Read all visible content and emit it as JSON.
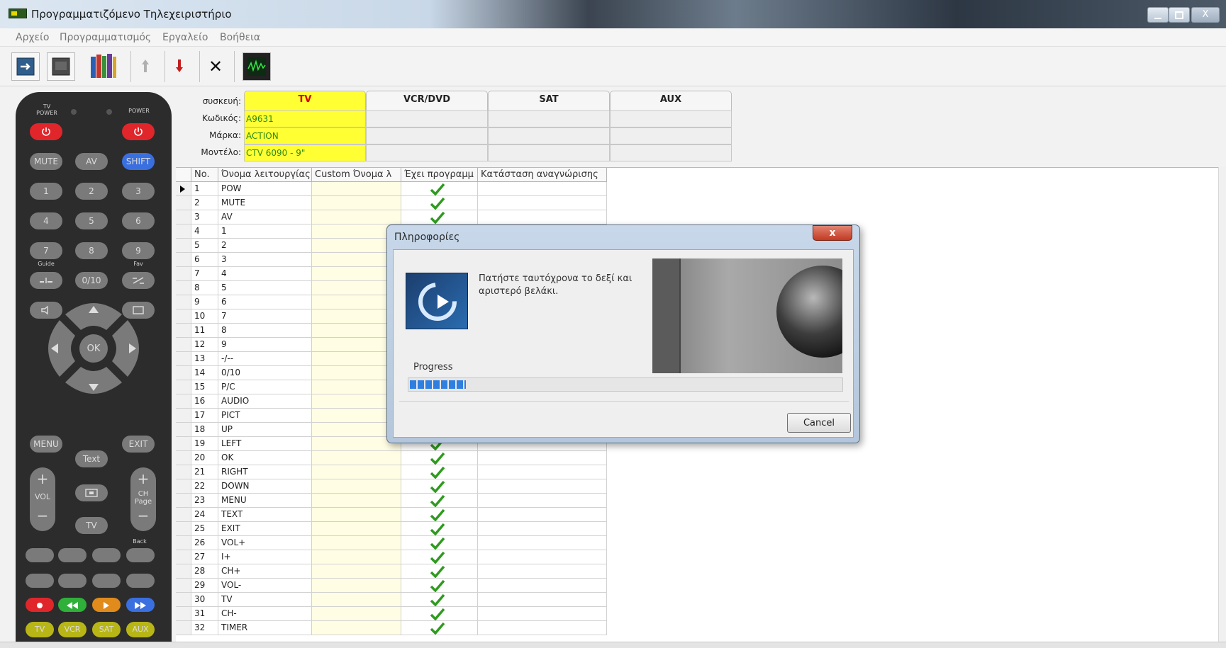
{
  "window": {
    "title": "Προγραμματιζόμενο Τηλεχειριστήριο",
    "close_symbol": "X"
  },
  "menu": [
    "Αρχείο",
    "Προγραμματισμός",
    "Εργαλείο",
    "Βοήθεια"
  ],
  "toolbar": {
    "delete_symbol": "✕"
  },
  "remote": {
    "tv_power": "TV POWER",
    "power": "POWER",
    "mute": "MUTE",
    "av": "AV",
    "shift": "SHIFT",
    "digits": [
      "1",
      "2",
      "3",
      "4",
      "5",
      "6",
      "7",
      "8",
      "9"
    ],
    "guide": "Guide",
    "fav": "Fav",
    "zero_ten": "0/10",
    "ok": "OK",
    "menu": "MENU",
    "exit": "EXIT",
    "text": "Text",
    "vol": "VOL",
    "ch_page": "CH Page",
    "back": "Back",
    "tv": "TV",
    "bottom_row": [
      "TV",
      "VCR",
      "SAT",
      "AUX"
    ],
    "accent_colors": {
      "red": "#e0262b",
      "green": "#2fb03a",
      "orange": "#e08b1c",
      "blue": "#3a6fe0",
      "yellow": "#b8b616"
    }
  },
  "device": {
    "labels": [
      "συσκευή:",
      "Κωδικός:",
      "Μάρκα:",
      "Μοντέλο:"
    ],
    "columns": [
      {
        "name": "TV",
        "code": "A9631",
        "brand": "ACTION",
        "model": "CTV 6090 - 9\""
      },
      {
        "name": "VCR/DVD",
        "code": "",
        "brand": "",
        "model": ""
      },
      {
        "name": "SAT",
        "code": "",
        "brand": "",
        "model": ""
      },
      {
        "name": "AUX",
        "code": "",
        "brand": "",
        "model": ""
      }
    ],
    "active_color": "#ffff33"
  },
  "table": {
    "headers": [
      "No.",
      "Όνομα λειτουργίας",
      "Custom Όνομα λ",
      "Έχει προγραμμ",
      "Κατάσταση αναγνώρισης"
    ],
    "rows": [
      {
        "no": "1",
        "name": "POW",
        "programmed": true
      },
      {
        "no": "2",
        "name": "MUTE",
        "programmed": true
      },
      {
        "no": "3",
        "name": "AV",
        "programmed": true
      },
      {
        "no": "4",
        "name": "1",
        "programmed": false
      },
      {
        "no": "5",
        "name": "2",
        "programmed": false
      },
      {
        "no": "6",
        "name": "3",
        "programmed": false
      },
      {
        "no": "7",
        "name": "4",
        "programmed": false
      },
      {
        "no": "8",
        "name": "5",
        "programmed": false
      },
      {
        "no": "9",
        "name": "6",
        "programmed": false
      },
      {
        "no": "10",
        "name": "7",
        "programmed": false
      },
      {
        "no": "11",
        "name": "8",
        "programmed": false
      },
      {
        "no": "12",
        "name": "9",
        "programmed": false
      },
      {
        "no": "13",
        "name": "-/--",
        "programmed": false
      },
      {
        "no": "14",
        "name": "0/10",
        "programmed": false
      },
      {
        "no": "15",
        "name": "P/C",
        "programmed": false
      },
      {
        "no": "16",
        "name": "AUDIO",
        "programmed": false
      },
      {
        "no": "17",
        "name": "PICT",
        "programmed": false
      },
      {
        "no": "18",
        "name": "UP",
        "programmed": false
      },
      {
        "no": "19",
        "name": "LEFT",
        "programmed": true
      },
      {
        "no": "20",
        "name": "OK",
        "programmed": true
      },
      {
        "no": "21",
        "name": "RIGHT",
        "programmed": true
      },
      {
        "no": "22",
        "name": "DOWN",
        "programmed": true
      },
      {
        "no": "23",
        "name": "MENU",
        "programmed": true
      },
      {
        "no": "24",
        "name": "TEXT",
        "programmed": true
      },
      {
        "no": "25",
        "name": "EXIT",
        "programmed": true
      },
      {
        "no": "26",
        "name": "VOL+",
        "programmed": true
      },
      {
        "no": "27",
        "name": "I+",
        "programmed": true
      },
      {
        "no": "28",
        "name": "CH+",
        "programmed": true
      },
      {
        "no": "29",
        "name": "VOL-",
        "programmed": true
      },
      {
        "no": "30",
        "name": "TV",
        "programmed": true
      },
      {
        "no": "31",
        "name": "CH-",
        "programmed": true
      },
      {
        "no": "32",
        "name": "TIMER",
        "programmed": true
      }
    ],
    "check_color": "#2f9a1f"
  },
  "dialog": {
    "title": "Πληροφορίες",
    "close_symbol": "x",
    "message": "Πατήστε ταυτόχρονα το δεξί και αριστερό βελάκι.",
    "progress_label": "Progress",
    "progress": 0.13,
    "cancel_label": "Cancel"
  }
}
